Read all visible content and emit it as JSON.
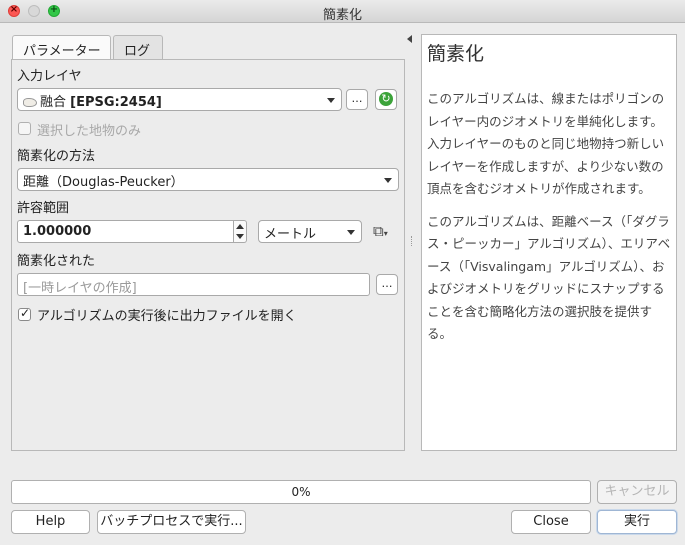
{
  "window": {
    "title": "簡素化"
  },
  "tabs": [
    {
      "label": "パラメーター"
    },
    {
      "label": "ログ"
    }
  ],
  "form": {
    "input_layer_label": "入力レイヤ",
    "input_layer_name": "融合",
    "input_layer_crs": "[EPSG:2454]",
    "browse_label": "…",
    "selected_only_label": "選択した地物のみ",
    "method_label": "簡素化の方法",
    "method_value": "距離（Douglas-Peucker）",
    "tolerance_label": "許容範囲",
    "tolerance_value": "1.000000",
    "unit_value": "メートル",
    "output_label": "簡素化された",
    "output_placeholder": "[一時レイヤの作成]",
    "open_output_label": "アルゴリズムの実行後に出力ファイルを開く"
  },
  "help": {
    "title": "簡素化",
    "paragraph1": "このアルゴリズムは、線またはポリゴンのレイヤー内のジオメトリを単純化します。入力レイヤーのものと同じ地物持つ新しいレイヤーを作成しますが、より少ない数の頂点を含むジオメトリが作成されます。",
    "paragraph2": "このアルゴリズムは、距離ベース（「ダグラス・ピーッカー」アルゴリズム）、エリアベース（「Visvalingam」アルゴリズム）、およびジオメトリをグリッドにスナップすることを含む簡略化方法の選択肢を提供する。"
  },
  "footer": {
    "progress_text": "0%",
    "progress_value": 0,
    "cancel_label": "キャンセル",
    "help_label": "Help",
    "batch_label": "バッチプロセスで実行...",
    "close_label": "Close",
    "run_label": "実行"
  }
}
